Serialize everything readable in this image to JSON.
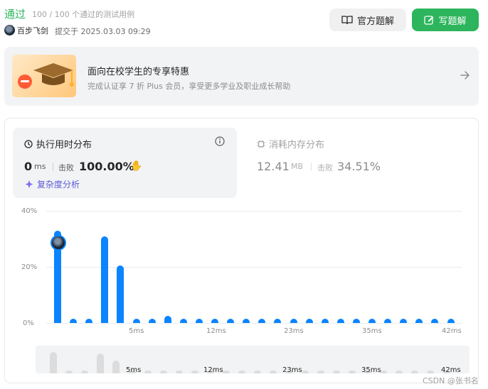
{
  "header": {
    "status": "通过",
    "status_detail": "100 / 100 个通过的测试用例",
    "author": "百步飞剑",
    "submit_time": "提交于 2025.03.03 09:29",
    "official_solution_label": "官方题解",
    "write_solution_label": "写题解"
  },
  "banner": {
    "title": "面向在校学生的专享特惠",
    "subtitle": "完成认证享 7 折 Plus 会员，享受更多学业及职业成长帮助"
  },
  "runtime": {
    "title": "执行用时分布",
    "value": "0",
    "unit": "ms",
    "beats_label": "击败",
    "beats_value": "100.00%",
    "complexity_label": "复杂度分析"
  },
  "memory": {
    "title": "消耗内存分布",
    "value": "12.41",
    "unit": "MB",
    "beats_label": "击败",
    "beats_value": "34.51%"
  },
  "chart_data": {
    "type": "bar",
    "y_ticks": [
      "40%",
      "20%",
      "0%"
    ],
    "ylim": [
      0,
      40
    ],
    "x_tick_labels": [
      "5ms",
      "12ms",
      "23ms",
      "35ms",
      "42ms"
    ],
    "values": [
      33.0,
      1.5,
      1.5,
      31.0,
      20.5,
      1.5,
      1.5,
      2.5,
      1.5,
      1.5,
      1.5,
      1.5,
      1.5,
      1.5,
      1.5,
      1.5,
      1.5,
      1.5,
      1.5,
      1.5,
      1.5,
      1.5,
      1.5,
      1.5,
      1.5,
      1.5
    ],
    "bar_color": "#0a84ff",
    "mini_x_tick_labels": [
      "5ms",
      "12ms",
      "23ms",
      "35ms",
      "42ms"
    ]
  },
  "colors": {
    "accent_green": "#2db55d",
    "bar_blue": "#0a84ff"
  },
  "watermark": "CSDN @张书名"
}
